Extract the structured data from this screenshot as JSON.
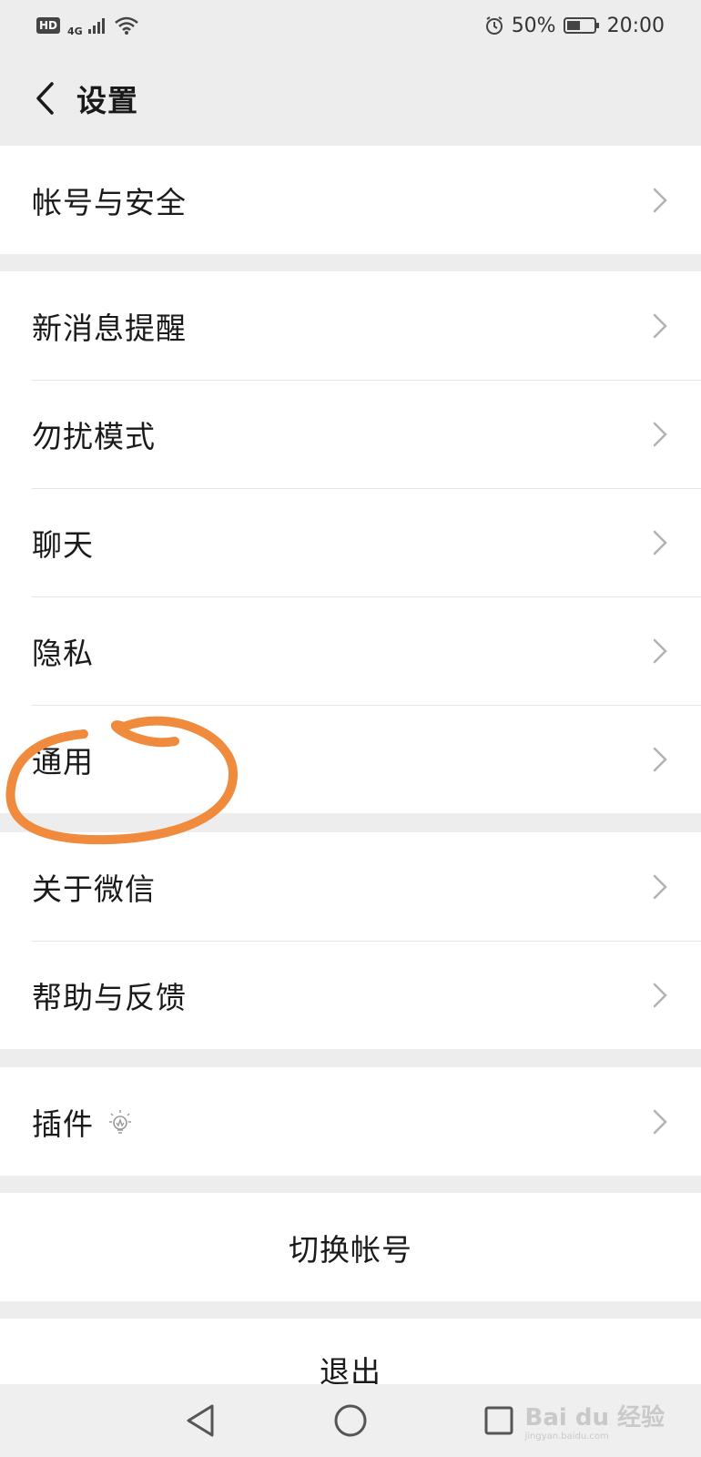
{
  "status_bar": {
    "hd": "HD",
    "network": "4G",
    "battery_percent": "50%",
    "time": "20:00",
    "battery_level": 0.5
  },
  "header": {
    "title": "设置"
  },
  "groups": [
    {
      "items": [
        {
          "label": "帐号与安全"
        }
      ]
    },
    {
      "items": [
        {
          "label": "新消息提醒"
        },
        {
          "label": "勿扰模式"
        },
        {
          "label": "聊天"
        },
        {
          "label": "隐私"
        },
        {
          "label": "通用"
        }
      ]
    },
    {
      "items": [
        {
          "label": "关于微信"
        },
        {
          "label": "帮助与反馈"
        }
      ]
    },
    {
      "items": [
        {
          "label": "插件",
          "icon": "lightbulb-icon"
        }
      ]
    }
  ],
  "switch_account": {
    "label": "切换帐号"
  },
  "logout": {
    "label": "退出"
  },
  "annotation_color": "#f08a3c",
  "bottom_nav": {
    "icons": [
      "back-triangle-icon",
      "home-circle-icon",
      "recents-square-icon"
    ]
  },
  "watermark": {
    "logo": "Bai du 经验",
    "sub": "jingyan.baidu.com"
  }
}
